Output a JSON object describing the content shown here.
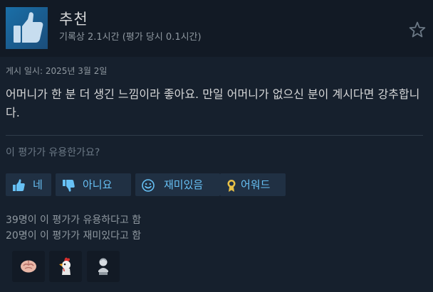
{
  "review": {
    "recommendation": "추천",
    "hours_line": "기록상 2.1시간 (평가 당시 0.1시간)",
    "posted": "게시 일시: 2025년 3월 2일",
    "text": "어머니가 한 분 더 생긴 느낌이라 좋아요. 만일 어머니가 없으신 분이 계시다면 강추합니다."
  },
  "icons": {
    "recommend": "thumbs-up-icon",
    "favorite": "star-icon",
    "yes": "thumbs-up-icon",
    "no": "thumbs-down-icon",
    "funny": "smiley-icon",
    "award": "award-medal-icon"
  },
  "feedback": {
    "question": "이 평가가 유용한가요?",
    "yes_label": "네",
    "no_label": "아니요",
    "funny_label": "재미있음",
    "award_label": "어워드"
  },
  "stats": {
    "helpful": "39명이 이 평가가 유용하다고 함",
    "funny": "20명이 이 평가가 재미있다고 함"
  },
  "awards": [
    "brain-award-icon",
    "rooster-award-icon",
    "bust-award-icon"
  ],
  "colors": {
    "accent": "#67c1f5",
    "background": "#16202d",
    "header_background": "#121a25",
    "button_background": "#203043"
  }
}
